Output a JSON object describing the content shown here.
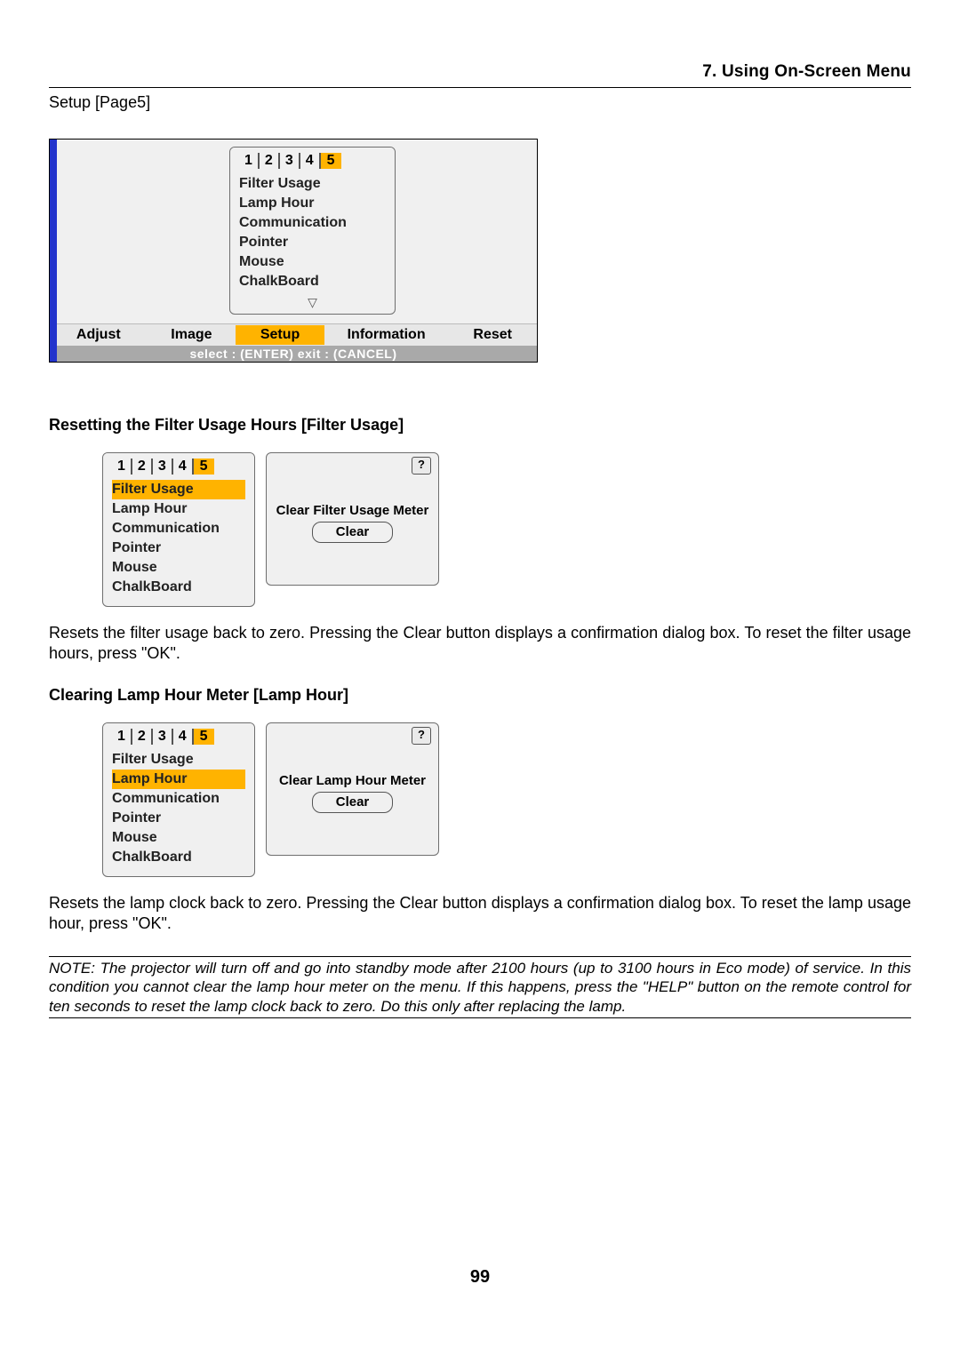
{
  "header": {
    "chapter": "7. Using On-Screen Menu"
  },
  "page_label": "Setup [Page5]",
  "page_tabs": [
    "1",
    "2",
    "3",
    "4",
    "5"
  ],
  "menu_items": [
    "Filter Usage",
    "Lamp Hour",
    "Communication",
    "Pointer",
    "Mouse",
    "ChalkBoard"
  ],
  "bottom_menu": {
    "adjust": "Adjust",
    "image": "Image",
    "setup": "Setup",
    "info": "Information",
    "reset": "Reset"
  },
  "footer_hint": "select : (ENTER)    exit : (CANCEL)",
  "section1": {
    "heading": "Resetting the Filter Usage Hours [Filter Usage]",
    "right_label": "Clear Filter Usage Meter",
    "clear": "Clear",
    "body": "Resets the filter usage back to zero. Pressing the Clear button displays a confirmation dialog box. To reset the filter usage hours, press \"OK\"."
  },
  "section2": {
    "heading": "Clearing Lamp Hour Meter [Lamp Hour]",
    "right_label": "Clear Lamp Hour Meter",
    "clear": "Clear",
    "body": "Resets the lamp clock back to zero. Pressing the Clear button displays a confirmation dialog box. To reset the lamp usage hour, press \"OK\"."
  },
  "note": "NOTE: The projector will turn off and go into standby mode after 2100 hours (up to 3100 hours in Eco mode) of service. In this condition you cannot clear the lamp hour meter on the menu. If this happens, press the \"HELP\" button on the remote control for ten seconds to reset the lamp clock back to zero. Do this only after replacing the lamp.",
  "help_icon": "?",
  "triangle": "▽",
  "page_number": "99"
}
